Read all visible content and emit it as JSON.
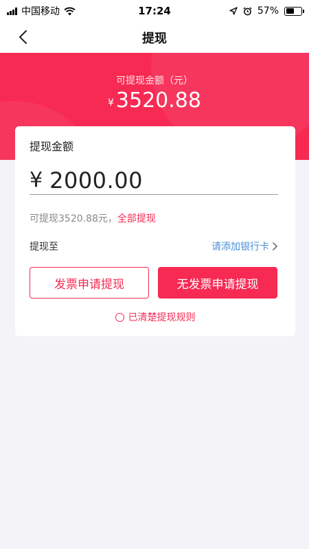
{
  "status_bar": {
    "carrier": "中国移动",
    "time": "17:24",
    "battery_percent": "57%",
    "battery_level": 0.57
  },
  "nav": {
    "title": "提现"
  },
  "hero": {
    "label": "可提现金额（元）",
    "currency": "¥",
    "amount": "3520.88"
  },
  "card": {
    "title": "提现金额",
    "currency": "¥",
    "amount": "2000.00",
    "available_text": "可提现3520.88元，",
    "withdraw_all": "全部提现",
    "withdraw_to_label": "提现至",
    "add_bank_card": "请添加银行卡"
  },
  "buttons": {
    "invoice": "发票申请提现",
    "no_invoice": "无发票申请提现"
  },
  "agreement": {
    "label": "已清楚提现规则"
  },
  "colors": {
    "accent": "#f72a53",
    "link": "#4a8fd6",
    "background": "#f4f3f7"
  }
}
